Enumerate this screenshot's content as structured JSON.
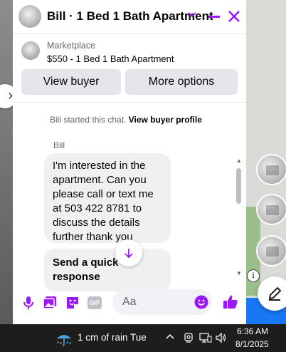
{
  "chat": {
    "title": "Bill · 1 Bed 1 Bath Apartment",
    "listing_category": "Marketplace",
    "listing_title": "$550 - 1 Bed 1 Bath Apartment",
    "view_buyer_label": "View buyer",
    "more_options_label": "More options",
    "system_message": "Bill started this chat.",
    "system_link": "View buyer profile",
    "sender_name": "Bill",
    "message_text": "I'm interested in the apartment. Can you please call or text me at 503 422 8781 to discuss the details further thank you",
    "quick_response_label": "Send a quick response",
    "input_placeholder": "Aa",
    "gif_label": "GIF"
  },
  "colors": {
    "accent": "#9b19f5",
    "facebook_blue": "#1877f2"
  },
  "taskbar": {
    "weather": "1 cm of rain Tue",
    "time": "6:36 AM",
    "date": "8/1/2025"
  }
}
